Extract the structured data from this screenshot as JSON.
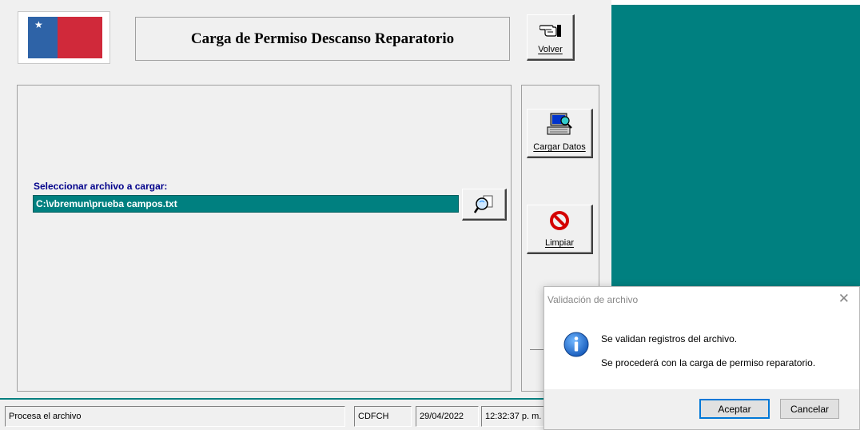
{
  "header": {
    "title": "Carga de Permiso Descanso Reparatorio"
  },
  "toolbar": {
    "volver_label": "Volver",
    "cargar_label": "Cargar Datos",
    "limpiar_label": "Limpiar"
  },
  "file": {
    "label": "Seleccionar archivo a cargar:",
    "value": "C:\\vbremun\\prueba campos.txt"
  },
  "status_bar": {
    "message": "Procesa el archivo",
    "user": "CDFCH",
    "date": "29/04/2022",
    "time": "12:32:37 p. m."
  },
  "dialog": {
    "title": "Validación de archivo",
    "line1": "Se validan registros del archivo.",
    "line2": "Se procederá con la carga de permiso reparatorio.",
    "accept_label": "Aceptar",
    "cancel_label": "Cancelar"
  },
  "icons": {
    "logo": "government-logo",
    "volver": "pointing-hand-icon",
    "cargar": "computer-search-icon",
    "limpiar": "no-entry-icon",
    "browse": "magnifier-icon",
    "dialog": "info-icon"
  },
  "colors": {
    "teal": "#008080",
    "label_blue": "#00008b",
    "accent": "#0078d7"
  }
}
